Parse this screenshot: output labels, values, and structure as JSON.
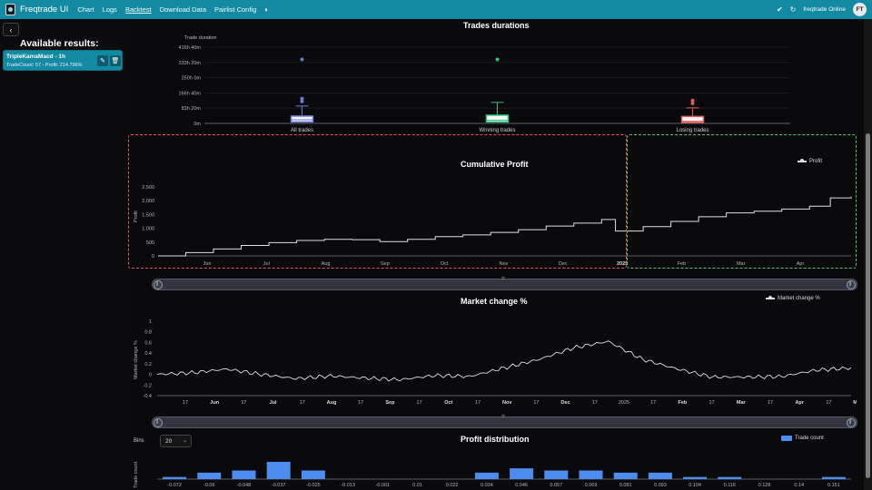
{
  "nav": {
    "brand": "Freqtrade UI",
    "links": [
      "Chart",
      "Logs",
      "Backtest",
      "Download Data",
      "Pairlist Config"
    ],
    "status": "freqtrade Online",
    "avatar": "FT"
  },
  "sidebar": {
    "back_icon": "chevron-left-icon",
    "title": "Available results:",
    "result": {
      "name": "TripleKamaMacd - 1h",
      "stats": "TradeCount: 57 - Profit: 214.796%"
    }
  },
  "colors": {
    "navbar": "#138aa2",
    "all_trades": "#6c7ad9",
    "winning": "#2ec27e",
    "losing": "#e05a5a",
    "bar": "#4e8df0",
    "highlight_red": "#e05a4e",
    "highlight_green": "#55c76a"
  },
  "trades_durations": {
    "title": "Trades durations",
    "axis_label": "Trade duration",
    "y_ticks": [
      "416h 40m",
      "333h 20m",
      "250h 0m",
      "166h 40m",
      "83h 20m",
      "0m"
    ],
    "categories": [
      "All trades",
      "Winning trades",
      "Losing trades"
    ]
  },
  "cumulative": {
    "title": "Cumulative Profit",
    "legend": "Profit",
    "y_ticks": [
      "2,500",
      "2,000",
      "1,500",
      "1,000",
      "500",
      "0"
    ],
    "y_label": "Profit",
    "x_ticks": [
      "Jun",
      "Jul",
      "Aug",
      "Sep",
      "Oct",
      "Nov",
      "Dec",
      "2025",
      "Feb",
      "Mar",
      "Apr"
    ]
  },
  "market": {
    "title": "Market change %",
    "legend": "Market change %",
    "y_label": "Market change %",
    "y_ticks": [
      "1",
      "0.8",
      "0.6",
      "0.4",
      "0.2",
      "0",
      "-0.2",
      "-0.4"
    ],
    "x_ticks": [
      "17",
      "Jun",
      "17",
      "Jul",
      "17",
      "Aug",
      "17",
      "Sep",
      "17",
      "Oct",
      "17",
      "Nov",
      "17",
      "Dec",
      "17",
      "2025",
      "17",
      "Feb",
      "17",
      "Mar",
      "17",
      "Apr",
      "17",
      "May"
    ]
  },
  "distribution": {
    "title": "Profit distribution",
    "legend": "Trade count",
    "bins_label": "Bins",
    "bins_value": "20",
    "y_label": "Trade count",
    "x_ticks": [
      "-0.072",
      "-0.06",
      "-0.048",
      "-0.037",
      "-0.025",
      "-0.013",
      "-0.001",
      "0.01",
      "0.022",
      "0.034",
      "0.046",
      "0.057",
      "0.069",
      "0.081",
      "0.093",
      "0.104",
      "0.116",
      "0.128",
      "0.14",
      "0.151"
    ]
  },
  "chart_data": [
    {
      "type": "box",
      "title": "Trades durations",
      "ylabel": "Trade duration",
      "categories": [
        "All trades",
        "Winning trades",
        "Losing trades"
      ],
      "ylim_hours": [
        0,
        416.67
      ],
      "box_hours": [
        {
          "min": 0,
          "q1": 8,
          "median": 20,
          "q3": 40,
          "max": 95,
          "outliers": [
            120,
            135,
            350
          ]
        },
        {
          "min": 0,
          "q1": 8,
          "median": 18,
          "q3": 45,
          "max": 115,
          "outliers": [
            350
          ]
        },
        {
          "min": 0,
          "q1": 5,
          "median": 12,
          "q3": 38,
          "max": 85,
          "outliers": [
            110,
            125
          ]
        }
      ]
    },
    {
      "type": "line",
      "title": "Cumulative Profit",
      "ylabel": "Profit",
      "series_name": "Profit",
      "ylim": [
        0,
        2500
      ],
      "x": [
        0,
        0.04,
        0.08,
        0.12,
        0.16,
        0.2,
        0.24,
        0.28,
        0.32,
        0.36,
        0.4,
        0.44,
        0.48,
        0.52,
        0.56,
        0.6,
        0.64,
        0.66,
        0.7,
        0.74,
        0.78,
        0.82,
        0.86,
        0.9,
        0.94,
        0.97,
        1.0
      ],
      "y": [
        0,
        120,
        250,
        380,
        480,
        560,
        600,
        590,
        520,
        600,
        700,
        760,
        850,
        950,
        1080,
        1190,
        1320,
        900,
        1060,
        1250,
        1420,
        1560,
        1620,
        1700,
        1800,
        2100,
        2150
      ]
    },
    {
      "type": "line",
      "title": "Market change %",
      "ylabel": "Market change %",
      "series_name": "Market change %",
      "ylim": [
        -0.4,
        1.0
      ],
      "x": [
        0,
        0.05,
        0.1,
        0.15,
        0.2,
        0.25,
        0.3,
        0.35,
        0.4,
        0.45,
        0.5,
        0.55,
        0.6,
        0.65,
        0.7,
        0.75,
        0.8,
        0.85,
        0.9,
        0.95,
        1.0
      ],
      "y": [
        0,
        0.03,
        0.1,
        0.0,
        -0.08,
        -0.03,
        -0.07,
        -0.1,
        -0.02,
        -0.04,
        0.12,
        0.28,
        0.5,
        0.62,
        0.28,
        0.1,
        -0.05,
        -0.05,
        -0.04,
        0.08,
        0.12
      ]
    },
    {
      "type": "bar",
      "title": "Profit distribution",
      "ylabel": "Trade count",
      "series_name": "Trade count",
      "categories": [
        "-0.072",
        "-0.06",
        "-0.048",
        "-0.037",
        "-0.025",
        "-0.013",
        "-0.001",
        "0.01",
        "0.022",
        "0.034",
        "0.046",
        "0.057",
        "0.069",
        "0.081",
        "0.093",
        "0.104",
        "0.116",
        "0.128",
        "0.14",
        "0.151"
      ],
      "values": [
        1,
        3,
        4,
        8,
        4,
        0,
        0,
        0,
        0,
        3,
        5,
        4,
        4,
        3,
        3,
        1,
        1,
        0,
        0,
        1
      ]
    }
  ]
}
